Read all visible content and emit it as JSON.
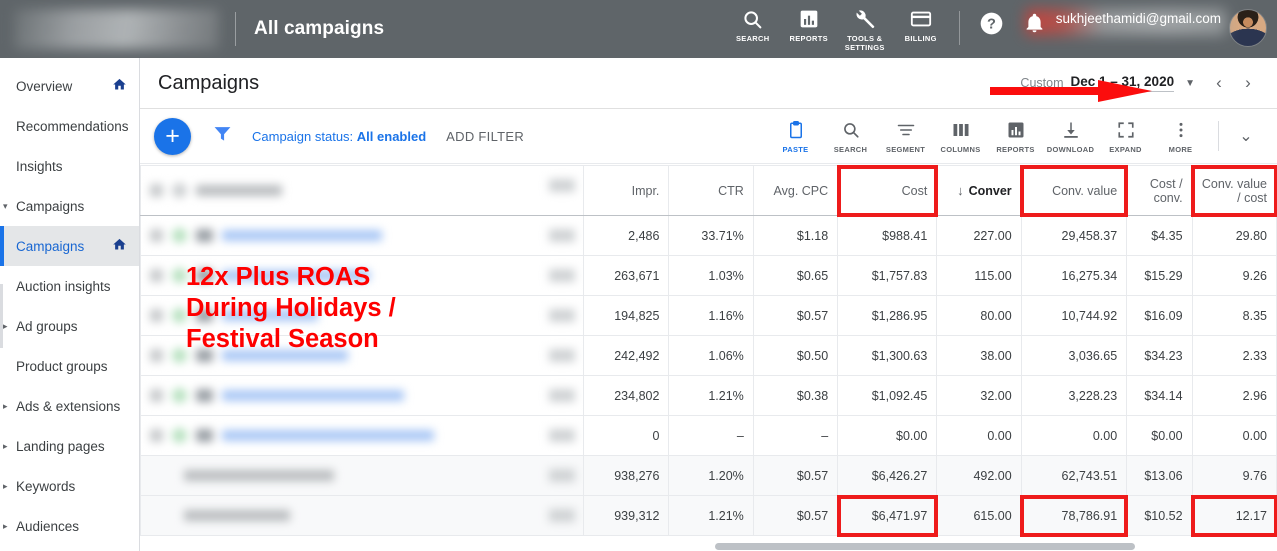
{
  "topbar": {
    "account_blurred": true,
    "title": "All campaigns",
    "icons": [
      {
        "name": "search-icon",
        "label": "SEARCH"
      },
      {
        "name": "reports-icon",
        "label": "REPORTS"
      },
      {
        "name": "tools-settings-icon",
        "label": "TOOLS &\nSETTINGS"
      },
      {
        "name": "billing-icon",
        "label": "BILLING"
      }
    ],
    "help_icon": "help-icon",
    "bell_icon": "notifications-bell-icon",
    "user_email": "sukhjeethamidi@gmail.com",
    "avatar": "user-avatar"
  },
  "sidebar": {
    "items": [
      {
        "label": "Overview",
        "home": true,
        "caret": "",
        "active": false
      },
      {
        "label": "Recommendations",
        "home": false,
        "caret": "",
        "active": false
      },
      {
        "label": "Insights",
        "home": false,
        "caret": "",
        "active": false
      },
      {
        "label": "Campaigns",
        "home": false,
        "caret": "▾",
        "active": false
      },
      {
        "label": "Campaigns",
        "home": true,
        "caret": "",
        "active": true
      },
      {
        "label": "Auction insights",
        "home": false,
        "caret": "",
        "active": false
      },
      {
        "label": "Ad groups",
        "home": false,
        "caret": "▸",
        "active": false
      },
      {
        "label": "Product groups",
        "home": false,
        "caret": "",
        "active": false
      },
      {
        "label": "Ads & extensions",
        "home": false,
        "caret": "▸",
        "active": false
      },
      {
        "label": "Landing pages",
        "home": false,
        "caret": "▸",
        "active": false
      },
      {
        "label": "Keywords",
        "home": false,
        "caret": "▸",
        "active": false
      },
      {
        "label": "Audiences",
        "home": false,
        "caret": "▸",
        "active": false
      }
    ]
  },
  "page": {
    "title": "Campaigns",
    "date_range": {
      "preset_label": "Custom",
      "value": "Dec 1 – 31, 2020",
      "prev": "‹",
      "next": "›"
    }
  },
  "toolbar": {
    "add_button": "+",
    "filter_icon": "filter-icon",
    "status_chip_prefix": "Campaign status:",
    "status_chip_value": "All enabled",
    "add_filter": "ADD FILTER",
    "tools": [
      {
        "name": "paste-icon",
        "label": "PASTE"
      },
      {
        "name": "search-icon",
        "label": "SEARCH"
      },
      {
        "name": "segment-icon",
        "label": "SEGMENT"
      },
      {
        "name": "columns-icon",
        "label": "COLUMNS"
      },
      {
        "name": "reports-icon",
        "label": "REPORTS"
      },
      {
        "name": "download-icon",
        "label": "DOWNLOAD"
      },
      {
        "name": "expand-icon",
        "label": "EXPAND"
      },
      {
        "name": "more-icon",
        "label": "MORE"
      }
    ],
    "collapse_chevron": "⌄"
  },
  "table": {
    "headers": [
      {
        "label": "Impr.",
        "highlight": false,
        "sorted": false
      },
      {
        "label": "CTR",
        "highlight": false,
        "sorted": false
      },
      {
        "label": "Avg. CPC",
        "highlight": false,
        "sorted": false
      },
      {
        "label": "Cost",
        "highlight": true,
        "sorted": false
      },
      {
        "label": "Conver",
        "highlight": false,
        "sorted": true,
        "sort_arrow": "↓"
      },
      {
        "label": "Conv. value",
        "highlight": true,
        "sorted": false
      },
      {
        "label": "Cost /\nconv.",
        "highlight": false,
        "sorted": false
      },
      {
        "label": "Conv. value\n/ cost",
        "highlight": true,
        "sorted": false
      }
    ],
    "rows": [
      {
        "blurred_name": true,
        "totals": false,
        "cells": [
          "2,486",
          "33.71%",
          "$1.18",
          "$988.41",
          "227.00",
          "29,458.37",
          "$4.35",
          "29.80"
        ],
        "highlights": [
          false,
          false,
          false,
          false,
          false,
          false,
          false,
          false
        ]
      },
      {
        "blurred_name": true,
        "totals": false,
        "cells": [
          "263,671",
          "1.03%",
          "$0.65",
          "$1,757.83",
          "115.00",
          "16,275.34",
          "$15.29",
          "9.26"
        ],
        "highlights": [
          false,
          false,
          false,
          false,
          false,
          false,
          false,
          false
        ]
      },
      {
        "blurred_name": true,
        "totals": false,
        "cells": [
          "194,825",
          "1.16%",
          "$0.57",
          "$1,286.95",
          "80.00",
          "10,744.92",
          "$16.09",
          "8.35"
        ],
        "highlights": [
          false,
          false,
          false,
          false,
          false,
          false,
          false,
          false
        ]
      },
      {
        "blurred_name": true,
        "totals": false,
        "cells": [
          "242,492",
          "1.06%",
          "$0.50",
          "$1,300.63",
          "38.00",
          "3,036.65",
          "$34.23",
          "2.33"
        ],
        "highlights": [
          false,
          false,
          false,
          false,
          false,
          false,
          false,
          false
        ]
      },
      {
        "blurred_name": true,
        "totals": false,
        "cells": [
          "234,802",
          "1.21%",
          "$0.38",
          "$1,092.45",
          "32.00",
          "3,228.23",
          "$34.14",
          "2.96"
        ],
        "highlights": [
          false,
          false,
          false,
          false,
          false,
          false,
          false,
          false
        ]
      },
      {
        "blurred_name": true,
        "totals": false,
        "cells": [
          "0",
          "–",
          "–",
          "$0.00",
          "0.00",
          "0.00",
          "$0.00",
          "0.00"
        ],
        "highlights": [
          false,
          false,
          false,
          false,
          false,
          false,
          false,
          false
        ]
      },
      {
        "blurred_name": true,
        "totals": true,
        "cells": [
          "938,276",
          "1.20%",
          "$0.57",
          "$6,426.27",
          "492.00",
          "62,743.51",
          "$13.06",
          "9.76"
        ],
        "highlights": [
          false,
          false,
          false,
          false,
          false,
          false,
          false,
          false
        ]
      },
      {
        "blurred_name": true,
        "totals": true,
        "cells": [
          "939,312",
          "1.21%",
          "$0.57",
          "$6,471.97",
          "615.00",
          "78,786.91",
          "$10.52",
          "12.17"
        ],
        "highlights": [
          false,
          false,
          false,
          true,
          false,
          true,
          false,
          true
        ]
      }
    ]
  },
  "annotations": {
    "caption": "12x Plus ROAS\nDuring Holidays /\nFestival Season",
    "caption_color": "#fe0000",
    "highlight_color": "#ee1b1b",
    "arrow": "red-arrow-pointing-to-date-range"
  },
  "colors": {
    "topbar_bg": "#5f6569",
    "accent_blue": "#1a73e8",
    "link_blue": "#1967d2",
    "text_primary": "#202124",
    "text_secondary": "#5f6368",
    "border": "#e8eaed",
    "totals_bg": "#f8f9fa"
  }
}
